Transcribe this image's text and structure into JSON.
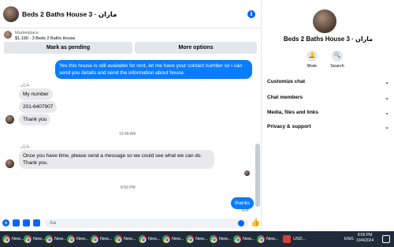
{
  "header": {
    "title": "Beds 2 Baths House 3 · ماران",
    "info_glyph": "i"
  },
  "marketplace": {
    "label": "Marketplace",
    "listing": "$1,190 - 3 Beds 2 Baths House",
    "pending_button": "Mark as pending",
    "more_button": "More options"
  },
  "messages": {
    "outgoing_1": "Yes this house is still available for rent, let me have your contact number so i can send you details and send the information about house.",
    "sender_1": "ماران",
    "incoming_1": "My number",
    "incoming_2": "201-6407907",
    "incoming_3": "Thank you",
    "time_1": "12:49 AM",
    "sender_2": "ماران",
    "incoming_4": "Once you have time, please send a message so we could see what we can do. Thank you.",
    "time_2": "8:56 PM",
    "outgoing_2": "thanks",
    "seen_label": "Sent"
  },
  "composer": {
    "placeholder": "Aa",
    "plus_glyph": "+",
    "like_glyph": "👍"
  },
  "sidebar": {
    "name": "Beds 2 Baths House 3 · ماران",
    "actions": [
      {
        "label": "Mute",
        "glyph": "🔔"
      },
      {
        "label": "Search",
        "glyph": "🔍"
      }
    ],
    "rows": [
      {
        "label": "Customize chat"
      },
      {
        "label": "Chat members"
      },
      {
        "label": "Media, files and links"
      },
      {
        "label": "Privacy & support"
      }
    ],
    "chevron": "⌄"
  },
  "taskbar": {
    "item_label": "New...",
    "currency": "USD...",
    "lang": "ENG",
    "time": "8:56 PM",
    "date": "10/4/2024"
  }
}
